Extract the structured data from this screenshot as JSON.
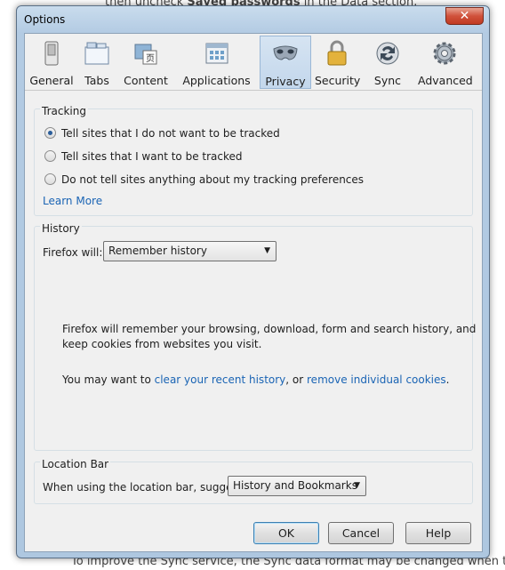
{
  "background_page": {
    "top_line_prefix": "then uncheck",
    "top_line_bold": "Saved passwords",
    "top_line_suffix": "in the Data section.",
    "bottom_line": "To improve the Sync service, the Sync data format may be changed when the"
  },
  "window": {
    "title": "Options",
    "close_glyph": "✕"
  },
  "toolbar": {
    "items": [
      {
        "label": "General"
      },
      {
        "label": "Tabs"
      },
      {
        "label": "Content"
      },
      {
        "label": "Applications"
      },
      {
        "label": "Privacy"
      },
      {
        "label": "Security"
      },
      {
        "label": "Sync"
      },
      {
        "label": "Advanced"
      }
    ],
    "selected": "Privacy"
  },
  "tracking": {
    "caption": "Tracking",
    "options": [
      "Tell sites that I do not want to be tracked",
      "Tell sites that I want to be tracked",
      "Do not tell sites anything about my tracking preferences"
    ],
    "selected_index": 0,
    "learn_more": "Learn More"
  },
  "history": {
    "caption": "History",
    "firefox_will_label": "Firefox will:",
    "select_value": "Remember history",
    "description_line1": "Firefox will remember your browsing, download, form and search history, and",
    "description_line2": "keep cookies from websites you visit.",
    "may_want_prefix": "You may want to",
    "clear_link": "clear your recent history",
    "or_text": ", or",
    "remove_link": "remove individual cookies",
    "period": "."
  },
  "location_bar": {
    "caption": "Location Bar",
    "suggest_label": "When using the location bar, suggest:",
    "select_value": "History and Bookmarks"
  },
  "buttons": {
    "ok": "OK",
    "cancel": "Cancel",
    "help": "Help"
  },
  "colors": {
    "accent": "#1a64b4",
    "selected_tab_bg": "#c3d7ec",
    "close_button": "#c13b22"
  }
}
